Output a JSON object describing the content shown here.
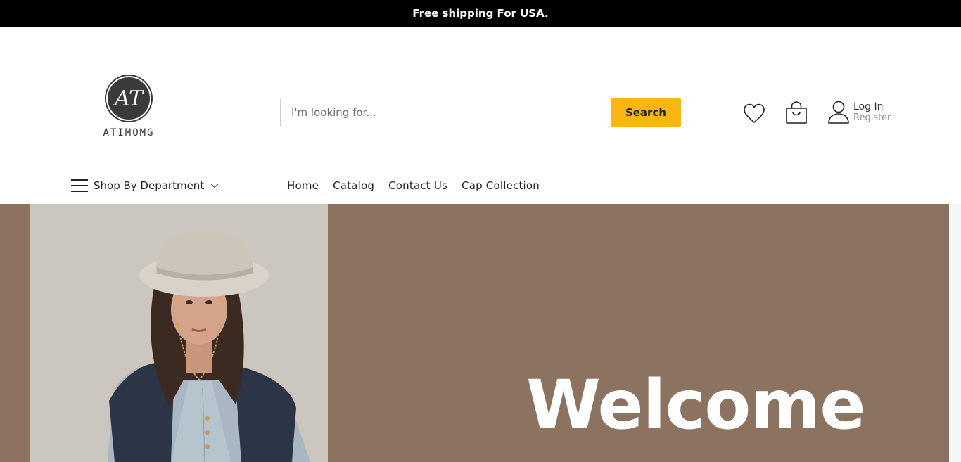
{
  "announcement": "Free shipping For USA.",
  "brand": {
    "monogram": "AT",
    "name": "ATIMOMG"
  },
  "search": {
    "placeholder": "I'm looking for...",
    "value": "",
    "button_label": "Search"
  },
  "account": {
    "login_label": "Log In",
    "register_label": "Register"
  },
  "nav": {
    "department_label": "Shop By Department",
    "menu": [
      "Home",
      "Catalog",
      "Contact Us",
      "Cap Collection"
    ]
  },
  "hero": {
    "headline": "Welcome"
  },
  "colors": {
    "topbar": "#000000",
    "accent": "#fbb710",
    "hero_background": "#8b7360",
    "text": "#222222"
  },
  "icons": [
    "menu-icon",
    "chevron-down-icon",
    "heart-icon",
    "shopping-bag-icon",
    "user-icon"
  ]
}
